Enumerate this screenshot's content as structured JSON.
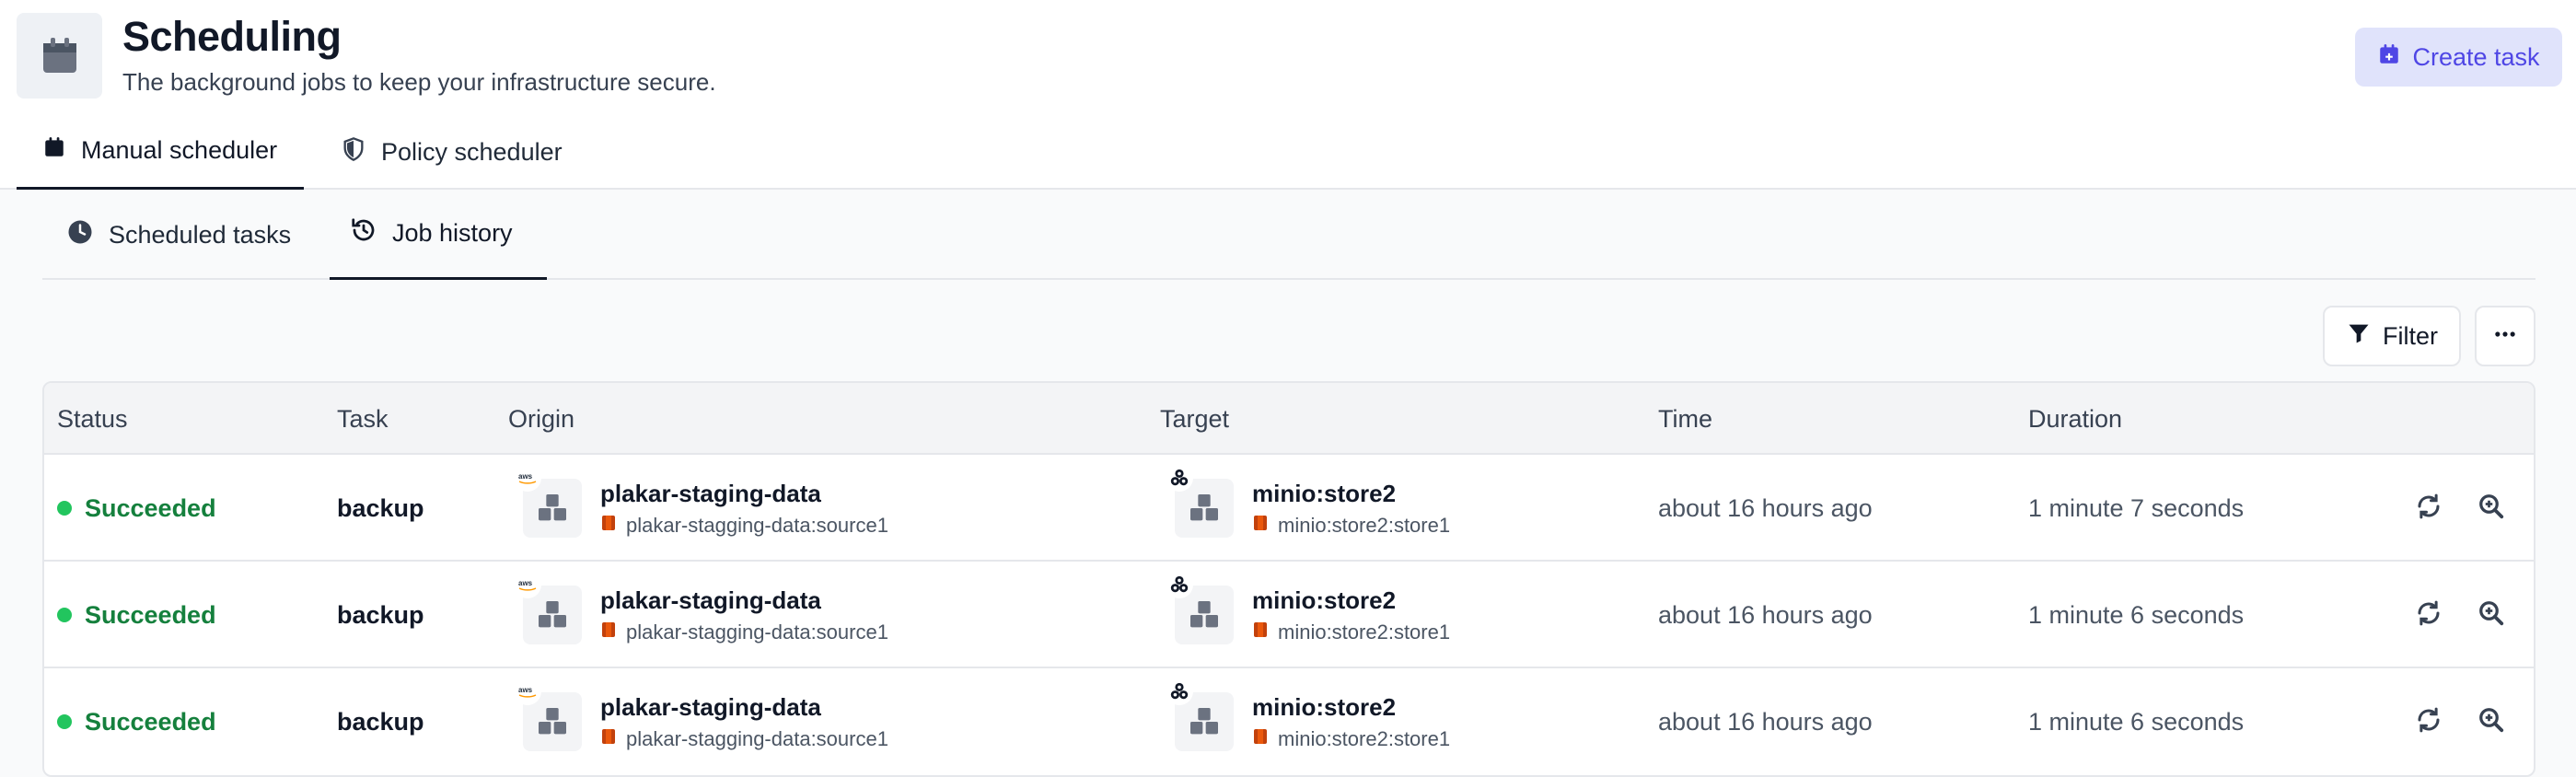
{
  "header": {
    "title": "Scheduling",
    "subtitle": "The background jobs to keep your infrastructure secure.",
    "icon": "calendar-icon",
    "create_label": "Create task"
  },
  "top_tabs": [
    {
      "label": "Manual scheduler",
      "icon": "calendar-icon",
      "active": true
    },
    {
      "label": "Policy scheduler",
      "icon": "shield-icon",
      "active": false
    }
  ],
  "sub_tabs": [
    {
      "label": "Scheduled tasks",
      "icon": "clock-icon",
      "active": false
    },
    {
      "label": "Job history",
      "icon": "history-icon",
      "active": true
    }
  ],
  "toolbar": {
    "filter_label": "Filter",
    "more_icon": "ellipsis-icon"
  },
  "table": {
    "columns": [
      "Status",
      "Task",
      "Origin",
      "Target",
      "Time",
      "Duration"
    ],
    "rows": [
      {
        "status": "Succeeded",
        "task": "backup",
        "origin_name": "plakar-staging-data",
        "origin_sub": "plakar-stagging-data:source1",
        "target_name": "minio:store2",
        "target_sub": "minio:store2:store1",
        "time": "about 16 hours ago",
        "duration": "1 minute 7 seconds"
      },
      {
        "status": "Succeeded",
        "task": "backup",
        "origin_name": "plakar-staging-data",
        "origin_sub": "plakar-stagging-data:source1",
        "target_name": "minio:store2",
        "target_sub": "minio:store2:store1",
        "time": "about 16 hours ago",
        "duration": "1 minute 6 seconds"
      },
      {
        "status": "Succeeded",
        "task": "backup",
        "origin_name": "plakar-staging-data",
        "origin_sub": "plakar-stagging-data:source1",
        "target_name": "minio:store2",
        "target_sub": "minio:store2:store1",
        "time": "about 16 hours ago",
        "duration": "1 minute 6 seconds"
      }
    ]
  },
  "colors": {
    "accent": "#4f46e5",
    "success": "#15803d",
    "success_dot": "#22c55e"
  }
}
